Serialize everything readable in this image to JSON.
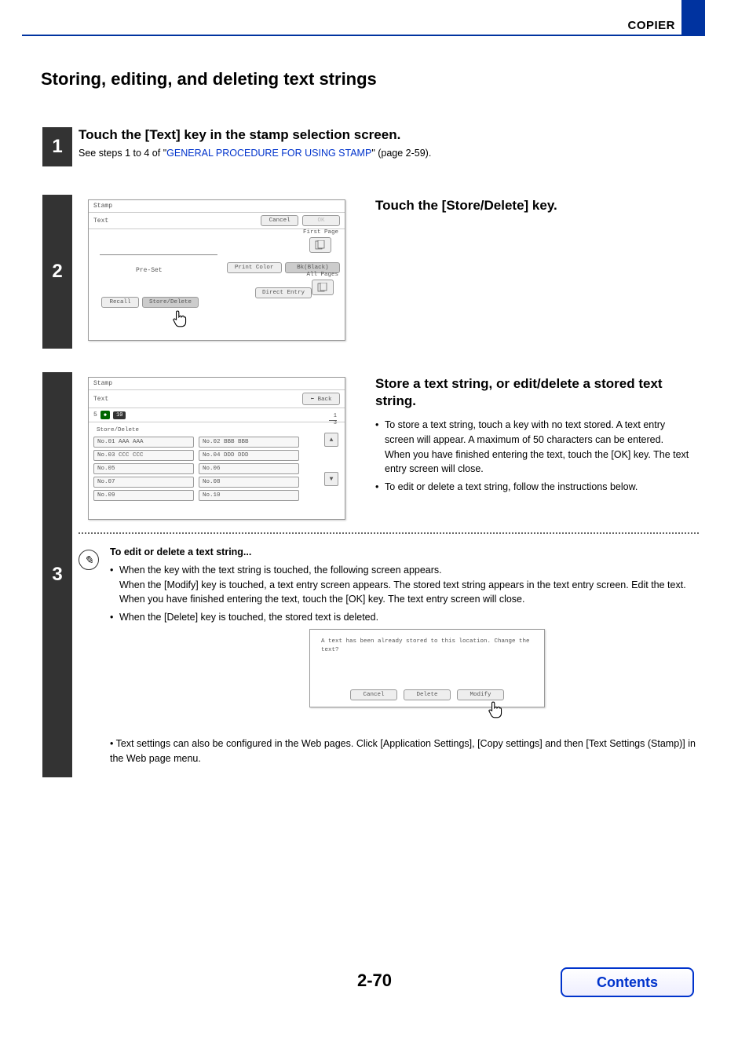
{
  "header": {
    "section": "COPIER"
  },
  "title": "Storing, editing, and deleting text strings",
  "step1": {
    "num": "1",
    "heading": "Touch the [Text] key in the stamp selection screen.",
    "sub_pre": "See steps 1 to 4 of \"",
    "link": "GENERAL PROCEDURE FOR USING STAMP",
    "sub_post": "\" (page 2-59)."
  },
  "step2": {
    "num": "2",
    "heading": "Touch the [Store/Delete] key.",
    "panel": {
      "title": "Stamp",
      "subtitle": "Text",
      "cancel": "Cancel",
      "ok": "OK",
      "preset": "Pre-Set",
      "recall": "Recall",
      "store_delete": "Store/Delete",
      "print_color": "Print Color",
      "bk": "Bk(Black)",
      "direct_entry": "Direct Entry",
      "first_page": "First Page",
      "all_pages": "All Pages"
    }
  },
  "step3": {
    "num": "3",
    "heading": "Store a text string, or edit/delete a stored text string.",
    "b1": "To store a text string, touch a key with no text stored. A text entry screen will appear. A maximum of 50 characters can be entered. When you have finished entering the text, touch the [OK] key. The text entry screen will close.",
    "b2": "To edit or delete a text string, follow the instructions below.",
    "panel": {
      "title": "Stamp",
      "subtitle": "Text",
      "back": "Back",
      "count_left": "5",
      "count_right": "10",
      "list_title": "Store/Delete",
      "page_top": "1",
      "page_bot": "3",
      "items": [
        "No.01 AAA AAA",
        "No.02 BBB BBB",
        "No.03 CCC CCC",
        "No.04 DDD DDD",
        "No.05",
        "No.06",
        "No.07",
        "No.08",
        "No.09",
        "No.10"
      ]
    },
    "note": {
      "title": "To edit or delete a text string...",
      "l1": "When the key with the text string is touched, the following screen appears.",
      "l1b": "When the [Modify] key is touched, a text entry screen appears. The stored text string appears in the text entry screen. Edit the text. When you have finished entering the text, touch the [OK] key. The text entry screen will close.",
      "l2": "When the [Delete] key is touched, the stored text is deleted."
    },
    "dialog": {
      "msg": "A text has been already stored to this location. Change the text?",
      "cancel": "Cancel",
      "delete": "Delete",
      "modify": "Modify"
    },
    "final": "Text settings can also be configured in the Web pages. Click [Application Settings], [Copy settings] and then [Text Settings (Stamp)] in the Web page menu."
  },
  "page_number": "2-70",
  "contents": "Contents"
}
